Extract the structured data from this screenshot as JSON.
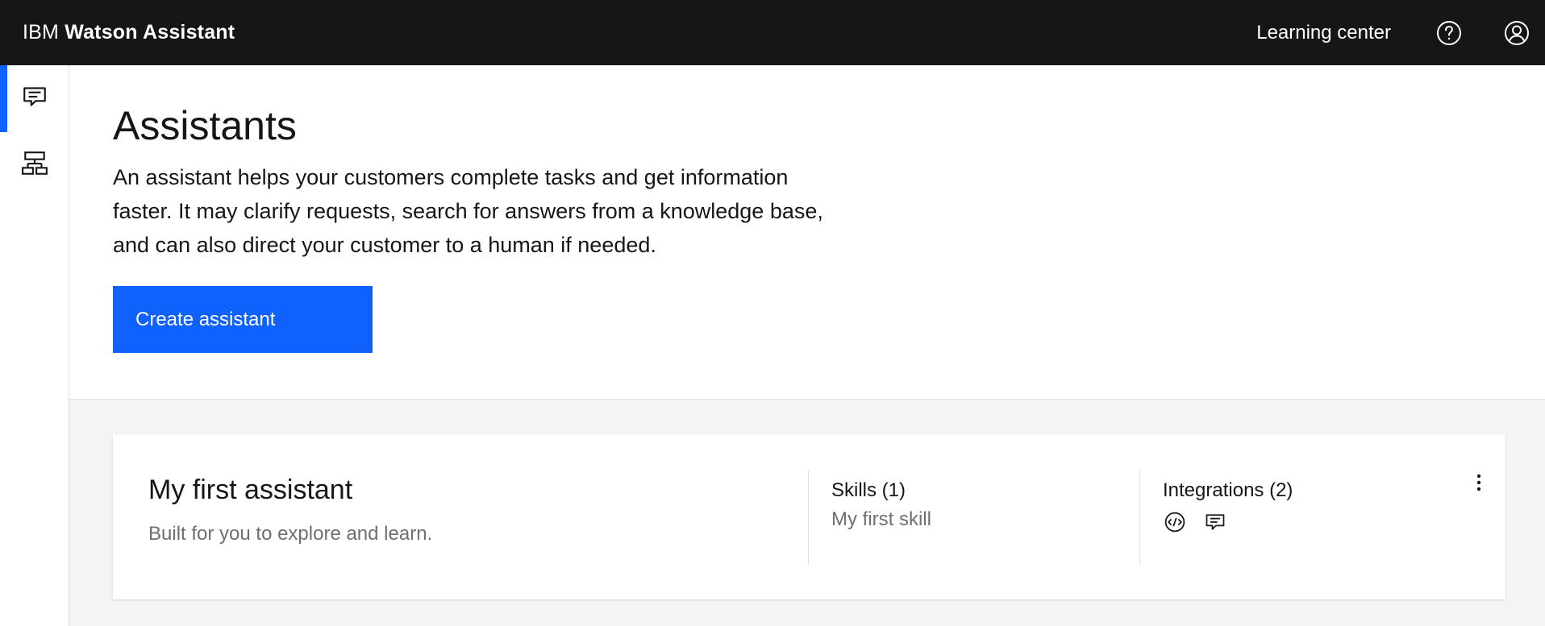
{
  "header": {
    "brand_prefix": "IBM",
    "brand_name": "Watson Assistant",
    "learning_center": "Learning center",
    "icons": {
      "help": "help-circle-icon",
      "user": "user-avatar-icon"
    }
  },
  "rail": {
    "items": [
      {
        "icon": "chat-icon",
        "active": true
      },
      {
        "icon": "skills-tree-icon",
        "active": false
      }
    ]
  },
  "page": {
    "title": "Assistants",
    "description": "An assistant helps your customers complete tasks and get information faster. It may clarify requests, search for answers from a knowledge base, and can also direct your customer to a human if needed.",
    "create_button": "Create assistant"
  },
  "assistants": [
    {
      "name": "My first assistant",
      "description": "Built for you to explore and learn.",
      "skills_heading": "Skills (1)",
      "skills": [
        "My first skill"
      ],
      "integrations_heading": "Integrations (2)",
      "integration_icons": [
        "web-chat-code-icon",
        "chat-icon"
      ]
    }
  ],
  "colors": {
    "header_bg": "#161616",
    "accent": "#0f62fe",
    "page_bg_gray": "#f4f4f4",
    "text_primary": "#161616",
    "text_secondary": "#6f6f6f"
  }
}
